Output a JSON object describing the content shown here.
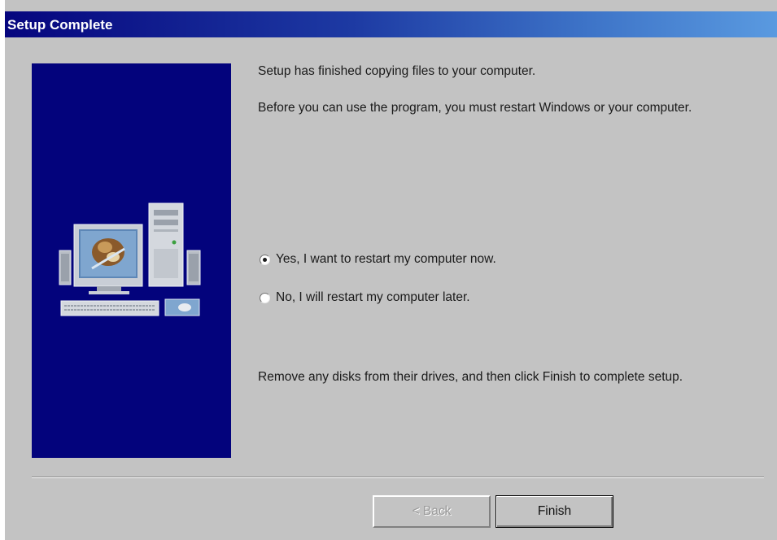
{
  "window": {
    "title": "Setup Complete"
  },
  "content": {
    "line1": "Setup has finished copying files to your computer.",
    "line2": "Before you can use the program, you must restart Windows or your computer.",
    "radio_yes": "Yes, I want to restart my computer now.",
    "radio_no": "No, I will restart my computer later.",
    "radio_selected": "yes",
    "line3": "Remove any disks from their drives, and then click Finish to complete setup."
  },
  "buttons": {
    "back": "< Back",
    "finish": "Finish"
  },
  "colors": {
    "dialog_bg": "#c3c3c3",
    "side_panel": "#03037c",
    "title_start": "#06057e",
    "title_end": "#5a9ae0"
  },
  "icons": {
    "side_image": "computer-setup-icon"
  }
}
